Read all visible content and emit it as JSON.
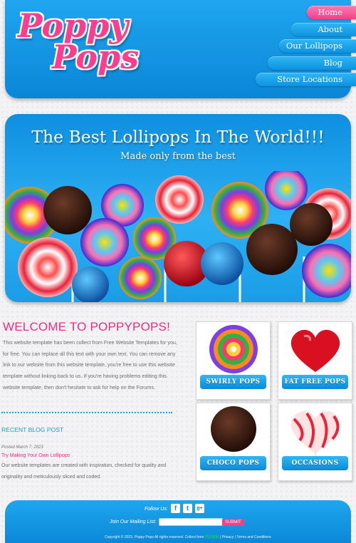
{
  "brand": {
    "logo_line1": "Poppy",
    "logo_line2": "Pops"
  },
  "nav": {
    "items": [
      {
        "label": "Home",
        "active": true
      },
      {
        "label": "About"
      },
      {
        "label": "Our Lollipops"
      },
      {
        "label": "Blog"
      },
      {
        "label": "Store Locations"
      }
    ]
  },
  "hero": {
    "title": "The Best Lollipops In The World!!!",
    "subtitle": "Made only from the best"
  },
  "welcome": {
    "title": "WELCOME TO POPPYPOPS!",
    "text": "This website template has been collect from Free Website Templates for you, for free. You can replace all this text with your own text. You can remove any link to our website from this website template, you're free to use this website template without linking back to us. If you're having problems editing this website template, then don't hesitate to ask for help on the Forums."
  },
  "blog": {
    "title": "RECENT BLOG POST",
    "posted": "Posted March 7, 2023",
    "link": "Try Making Your Own Lollipops",
    "text": "Our website templates are created with inspiration, checked for quality and originality and meticulously sliced and coded."
  },
  "products": [
    {
      "label": "SWIRLY POPS",
      "icon": "swirly-lollipop-image"
    },
    {
      "label": "FAT FREE POPS",
      "icon": "red-heart-lollipop-image"
    },
    {
      "label": "CHOCO POPS",
      "icon": "chocolate-lollipop-image"
    },
    {
      "label": "OCCASIONS",
      "icon": "striped-heart-lollipop-image"
    }
  ],
  "footer": {
    "follow_label": "Follow Us:",
    "social": [
      {
        "name": "facebook-icon",
        "glyph": "f"
      },
      {
        "name": "twitter-icon",
        "glyph": "t"
      },
      {
        "name": "googleplus-icon",
        "glyph": "g+"
      }
    ],
    "mailing_label": "Join Our Mailing List:",
    "mailing_value": "",
    "submit_label": "SUBMIT",
    "copyright": "Copyright © 2023. Poppy Pops All rights reserved. Collect from",
    "cgm": "网页模板",
    "privacy": "Privacy",
    "terms": "Terms and Conditions"
  },
  "colors": {
    "brand_blue": "#0b88d8",
    "brand_pink": "#f33f86",
    "heading_pink": "#ef2d7b",
    "link_blue": "#1f9be0"
  }
}
